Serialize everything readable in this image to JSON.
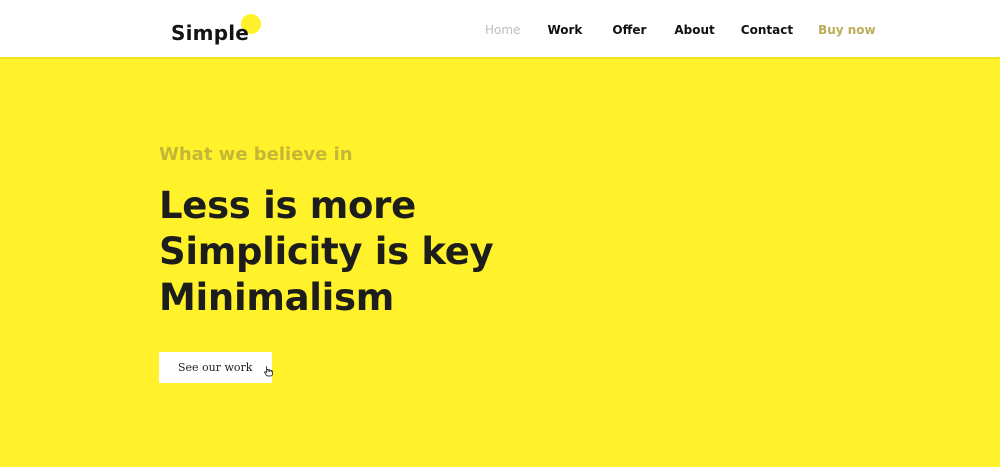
{
  "header": {
    "logo_text": "Simple",
    "nav": {
      "home": "Home",
      "work": "Work",
      "offer": "Offer",
      "about": "About",
      "contact": "Contact",
      "buy": "Buy now"
    }
  },
  "hero": {
    "eyebrow": "What we believe in",
    "lines": [
      "Less is more",
      "Simplicity is key",
      "Minimalism"
    ],
    "cta_label": "See our work",
    "cta_icon": "pointer-hand-icon"
  },
  "colors": {
    "background": "#fff22b",
    "header_bg": "#ffffff",
    "text_dark": "#1d1d1b",
    "eyebrow": "#c4b636",
    "nav_muted": "#bdbdbd",
    "nav_buy": "#b9ad59"
  }
}
